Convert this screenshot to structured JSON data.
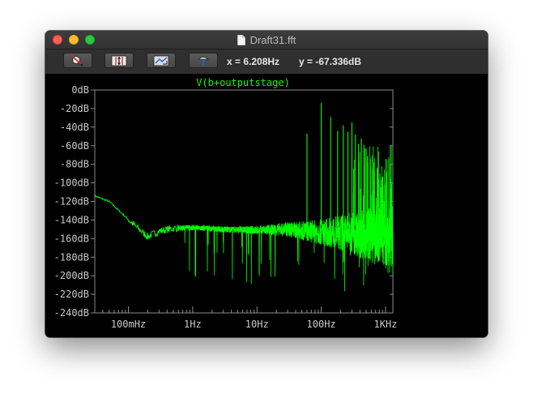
{
  "window": {
    "title": "Draft31.fft"
  },
  "toolbar": {
    "buttons": [
      {
        "name": "zoom-full-button",
        "icon": "zoom-cancel-icon"
      },
      {
        "name": "autorange-y-button",
        "icon": "autorange-icon"
      },
      {
        "name": "zoom-out-button",
        "icon": "zoom-out-icon"
      },
      {
        "name": "paint-button",
        "icon": "hammer-icon"
      }
    ],
    "cursor_x": "x = 6.208Hz",
    "cursor_y": "y = -67.336dB"
  },
  "colors": {
    "trace": "#00ff00",
    "grid": "#8a8a8a",
    "axis_text": "#c8c8c8",
    "background": "#000000"
  },
  "chart_data": {
    "type": "line",
    "title": "V(b+outputstage)",
    "x_scale": "log",
    "xlim_hz": [
      0.03,
      1300
    ],
    "ylim_db": [
      -240,
      0
    ],
    "y_ticks": [
      "0dB",
      "-20dB",
      "-40dB",
      "-60dB",
      "-80dB",
      "-100dB",
      "-120dB",
      "-140dB",
      "-160dB",
      "-180dB",
      "-200dB",
      "-220dB",
      "-240dB"
    ],
    "x_ticks": [
      "100mHz",
      "1Hz",
      "10Hz",
      "100Hz",
      "1KHz"
    ],
    "baseline_points_hz_db": [
      [
        0.03,
        -114
      ],
      [
        0.05,
        -120
      ],
      [
        0.08,
        -133
      ],
      [
        0.12,
        -145
      ],
      [
        0.2,
        -158
      ],
      [
        0.3,
        -152
      ],
      [
        0.5,
        -149
      ],
      [
        1,
        -148
      ],
      [
        3,
        -150
      ],
      [
        10,
        -151
      ],
      [
        30,
        -150
      ],
      [
        60,
        -152
      ],
      [
        100,
        -153
      ],
      [
        300,
        -154
      ],
      [
        800,
        -157
      ],
      [
        1300,
        -160
      ]
    ],
    "harmonic_peaks_hz_db": [
      [
        60,
        -47
      ],
      [
        100,
        -14
      ],
      [
        140,
        -29
      ],
      [
        180,
        -44
      ],
      [
        220,
        -38
      ],
      [
        260,
        -45
      ],
      [
        300,
        -35
      ],
      [
        340,
        -48
      ],
      [
        380,
        -58
      ],
      [
        420,
        -52
      ],
      [
        460,
        -59
      ],
      [
        500,
        -63
      ],
      [
        580,
        -75
      ],
      [
        660,
        -78
      ],
      [
        740,
        -84
      ],
      [
        820,
        -90
      ],
      [
        900,
        -96
      ],
      [
        980,
        -103
      ]
    ],
    "grid": true
  }
}
